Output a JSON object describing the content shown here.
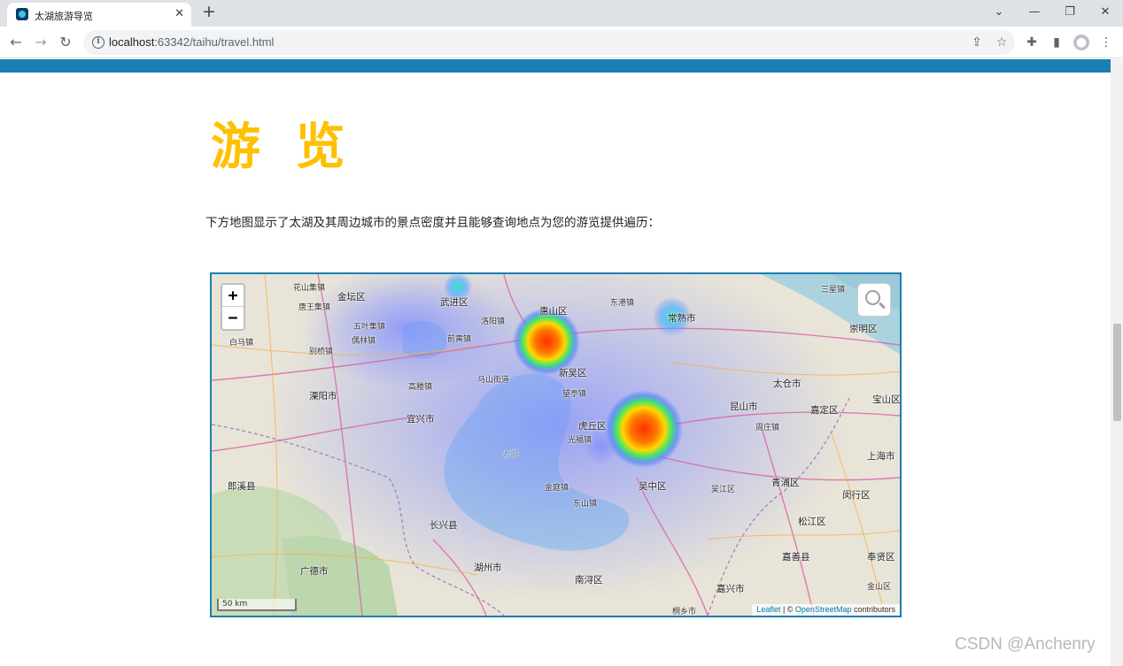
{
  "browser": {
    "tab_title": "太湖旅游导览",
    "new_tab_icon": "plus-icon",
    "url_host": "localhost",
    "url_rest": ":63342/taihu/travel.html"
  },
  "page": {
    "heading": "游 览",
    "intro": "下方地图显示了太湖及其周边城市的景点密度并且能够查询地点为您的游览提供遍历："
  },
  "map": {
    "zoom_in": "+",
    "zoom_out": "−",
    "scale_label": "50 km",
    "attribution_leaflet": "Leaflet",
    "attribution_sep": " | © ",
    "attribution_osm": "OpenStreetMap",
    "attribution_tail": " contributors",
    "lake_label": "太湖",
    "heat_colors": [
      "#ff3000",
      "#ffd800",
      "#3ee66e",
      "#4a7dff"
    ],
    "places": [
      {
        "name": "花山集镇"
      },
      {
        "name": "金坛区"
      },
      {
        "name": "武进区"
      },
      {
        "name": "惠山区"
      },
      {
        "name": "常熟市"
      },
      {
        "name": "唐王集镇"
      },
      {
        "name": "五叶集镇"
      },
      {
        "name": "前黄镇"
      },
      {
        "name": "洛阳镇"
      },
      {
        "name": "东港镇"
      },
      {
        "name": "三星镇"
      },
      {
        "name": "崇明区"
      },
      {
        "name": "白马镇"
      },
      {
        "name": "别桥镇"
      },
      {
        "name": "偶林镇"
      },
      {
        "name": "新吴区"
      },
      {
        "name": "望亭镇"
      },
      {
        "name": "太仓市"
      },
      {
        "name": "溧阳市"
      },
      {
        "name": "宜兴市"
      },
      {
        "name": "高塍镇"
      },
      {
        "name": "虎丘区"
      },
      {
        "name": "昆山市"
      },
      {
        "name": "嘉定区"
      },
      {
        "name": "宝山区"
      },
      {
        "name": "吴中区"
      },
      {
        "name": "吴江区"
      },
      {
        "name": "青浦区"
      },
      {
        "name": "上海市"
      },
      {
        "name": "闵行区"
      },
      {
        "name": "松江区"
      },
      {
        "name": "郎溪县"
      },
      {
        "name": "长兴县"
      },
      {
        "name": "湖州市"
      },
      {
        "name": "南浔区"
      },
      {
        "name": "广德市"
      },
      {
        "name": "嘉善县"
      },
      {
        "name": "嘉兴市"
      },
      {
        "name": "奉贤区"
      },
      {
        "name": "金山区"
      },
      {
        "name": "马山街道"
      },
      {
        "name": "东山镇"
      },
      {
        "name": "周庄镇"
      },
      {
        "name": "光福镇"
      },
      {
        "name": "金庭镇"
      },
      {
        "name": "桐乡市"
      }
    ]
  },
  "watermark": "CSDN @Anchenry"
}
